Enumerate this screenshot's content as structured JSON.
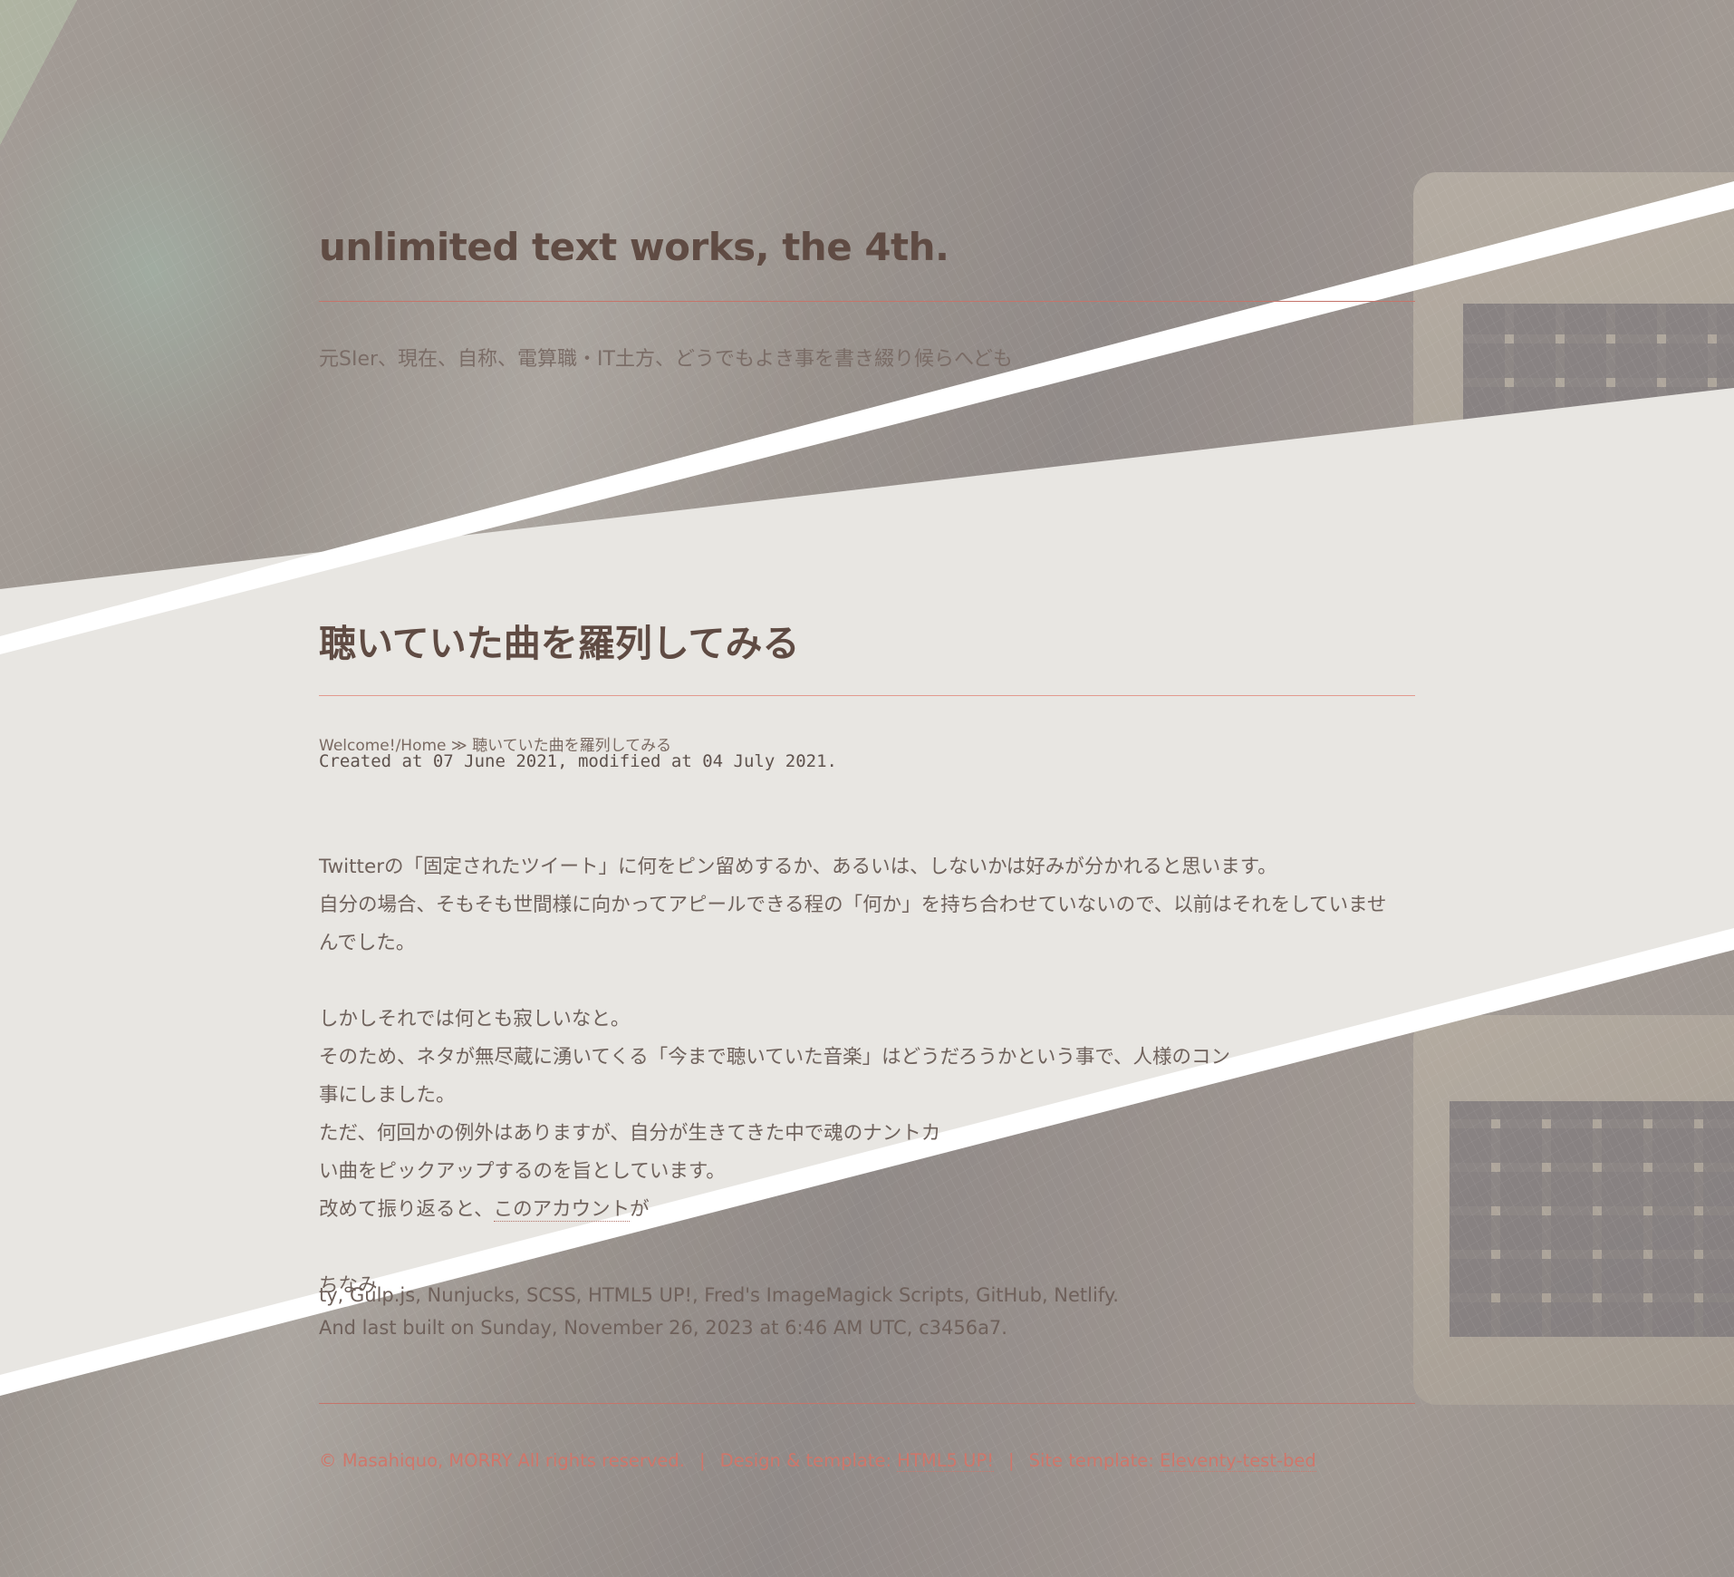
{
  "header": {
    "site_title": "unlimited text works, the 4th.",
    "subtitle": "元SIer、現在、自称、電算職・IT土方、どうでもよき事を書き綴り候らへども"
  },
  "post": {
    "title": "聴いていた曲を羅列してみる",
    "breadcrumb": {
      "home": "Welcome!/Home",
      "separator": " ≫ ",
      "current": "聴いていた曲を羅列してみる"
    },
    "meta": "Created at 07 June 2021, modified at 04 July 2021.",
    "body": {
      "p1_line1": "Twitterの「固定されたツイート」に何をピン留めするか、あるいは、しないかは好みが分かれると思います。",
      "p1_line2": "自分の場合、そもそも世間様に向かってアピールできる程の「何か」を持ち合わせていないので、以前はそれをしていませ",
      "p1_line3": "んでした。",
      "p2_line1": "しかしそれでは何とも寂しいなと。",
      "p2_line2": "そのため、ネタが無尽蔵に湧いてくる「今まで聴いていた音楽」はどうだろうかという事で、人様のコン",
      "p2_line3": "事にしました。",
      "p2_line4": "ただ、何回かの例外はありますが、自分が生きてきた中で魂のナントカ",
      "p2_line5": "い曲をピックアップするのを旨としています。",
      "p2_line6_prefix": "改めて振り返ると、",
      "p2_line6_link": "このアカウント",
      "p2_line6_suffix": "が",
      "p3_line1": "ちなみ"
    }
  },
  "built": {
    "line1": "ty, Gulp.js, Nunjucks, SCSS, HTML5 UP!, Fred's ImageMagick Scripts, GitHub, Netlify.",
    "line2": "And last built on Sunday, November 26, 2023 at 6:46 AM UTC, c3456a7."
  },
  "footer": {
    "copyright": "© Masahiquo, MORRY All rights reserved.",
    "separator": "|",
    "design_label": "Design & template:",
    "design_link": "HTML5 UP!",
    "site_label": "Site template:",
    "site_link": "Eleventy-test-bed"
  },
  "colors": {
    "band": "#e8e6e2",
    "stripe": "#ffffff",
    "title": "#5f4b43",
    "accent_rule": "#c5746a",
    "footer_link": "#d0766a"
  },
  "icons": {
    "breadcrumb_separator": "double-chevron-right"
  }
}
